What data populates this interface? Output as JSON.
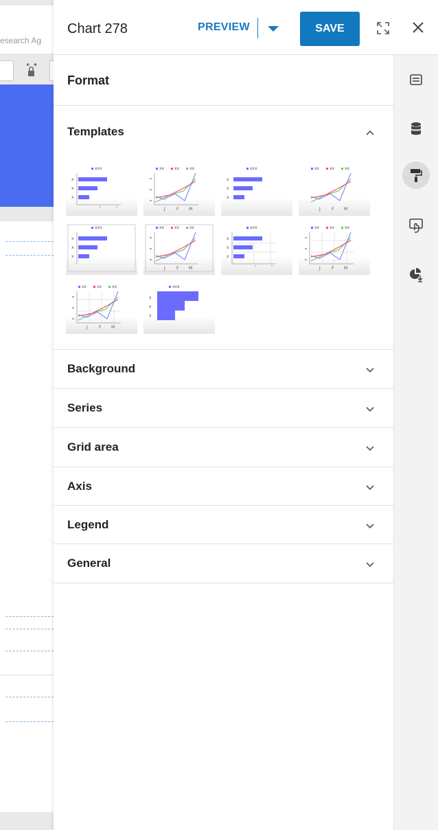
{
  "background": {
    "search_text": "esearch Ag"
  },
  "header": {
    "title": "Chart 278",
    "preview_label": "PREVIEW",
    "save_label": "SAVE"
  },
  "format": {
    "title": "Format"
  },
  "templates": {
    "title": "Templates",
    "expanded": true,
    "legend_single": "xxx",
    "legend_multi": [
      "xx",
      "xx",
      "xx"
    ],
    "row_labels": [
      "x",
      "x",
      "x"
    ],
    "month_labels": [
      "J",
      "F",
      "M"
    ],
    "items": [
      {
        "kind": "hbar"
      },
      {
        "kind": "line"
      },
      {
        "kind": "hbar-plain"
      },
      {
        "kind": "line-plain"
      },
      {
        "kind": "hbar-framed"
      },
      {
        "kind": "line-framed"
      },
      {
        "kind": "hbar-grid"
      },
      {
        "kind": "line-grid"
      },
      {
        "kind": "line-grid-alt"
      },
      {
        "kind": "step-area"
      }
    ]
  },
  "sections": [
    {
      "label": "Background",
      "expanded": false
    },
    {
      "label": "Series",
      "expanded": false
    },
    {
      "label": "Grid area",
      "expanded": false
    },
    {
      "label": "Axis",
      "expanded": false
    },
    {
      "label": "Legend",
      "expanded": false
    },
    {
      "label": "General",
      "expanded": false
    }
  ],
  "rail": [
    {
      "icon": "text-box-icon",
      "active": false
    },
    {
      "icon": "database-icon",
      "active": false
    },
    {
      "icon": "paint-roller-icon",
      "active": true
    },
    {
      "icon": "touch-screen-icon",
      "active": false
    },
    {
      "icon": "pie-download-icon",
      "active": false
    }
  ],
  "colors": {
    "accent": "#1a7bbf",
    "save_button": "#1278bf",
    "series_blue": "#6b6bff",
    "series_red": "#ff4b6b",
    "series_green": "#5ad45a",
    "background_blue": "#4a6cf0"
  }
}
